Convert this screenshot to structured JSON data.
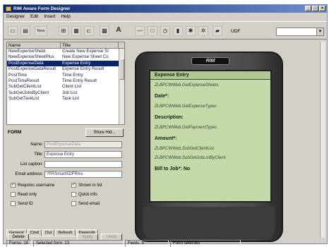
{
  "window": {
    "title": "RIM Aware Form Designer"
  },
  "menu": [
    "Designer",
    "Edit",
    "Insert",
    "Help"
  ],
  "toolbar": {
    "buttons": [
      "new-icon",
      "open-icon",
      "save-icon",
      "form-icon",
      "table-icon",
      "insert-icon",
      "text-icon",
      "font-icon",
      "line-icon",
      "box-icon",
      "clock-icon",
      "star-icon",
      "gear-icon",
      "folder-icon"
    ],
    "wide_label": "New",
    "font_label": "A",
    "combo_label": "UDF"
  },
  "list": {
    "headers": [
      "Name",
      "Title"
    ],
    "rows": [
      {
        "name": "NewExpenseSheet",
        "title": "Create New Expense Sl"
      },
      {
        "name": "NewExpenseSheetPlus",
        "title": "New Expense Sheet Co"
      },
      {
        "name": "PostExpenseData",
        "title": "Expense Entry",
        "selected": true
      },
      {
        "name": "PostExpenseDataResult",
        "title": "Expense Entry Result"
      },
      {
        "name": "PostTime",
        "title": "Time Entry"
      },
      {
        "name": "PostTimeResult",
        "title": "Time Entry Result"
      },
      {
        "name": "SubGetClientList",
        "title": "Client List"
      },
      {
        "name": "SubGetJobsByClient",
        "title": "Job List"
      },
      {
        "name": "SubGetTaskList",
        "title": "Task List"
      }
    ]
  },
  "formbar": {
    "label": "FORM",
    "show_button": "Show Hid..."
  },
  "props": {
    "name_label": "Name:",
    "name_value": "PostExpenseData",
    "title_label": "Title:",
    "title_value": "Expense Entry",
    "caption_label": "List caption:",
    "caption_value": "",
    "email_label": "Email address:",
    "email_value": "?FRSmartSDFRms",
    "checks": [
      {
        "label": "Requires username",
        "checked": true
      },
      {
        "label": "Shown in list",
        "checked": true
      },
      {
        "label": "Read only",
        "checked": false
      },
      {
        "label": "Quick info",
        "checked": false
      },
      {
        "label": "Send ID",
        "checked": false
      },
      {
        "label": "Send email",
        "checked": false
      }
    ]
  },
  "tabs": [
    "General",
    "Cmd",
    "Out",
    "Refresh",
    "Depends"
  ],
  "bottom": {
    "delete": "Delete",
    "apply": "Apply",
    "undo": "Undo"
  },
  "device": {
    "logo": "RIM",
    "screen_title": "Expense Entry",
    "lines": [
      {
        "kind": "code",
        "text": "ZLBPCWWeb.GetExpenseSheets"
      },
      {
        "kind": "label",
        "text": "Date*:"
      },
      {
        "kind": "code",
        "text": "ZLBPCWWeb.GetExpenseTypes"
      },
      {
        "kind": "label",
        "text": "Description:"
      },
      {
        "kind": "code",
        "text": "ZLBPCWWeb.GetPaymentTypes"
      },
      {
        "kind": "label",
        "text": "Amount*:"
      },
      {
        "kind": "code",
        "text": "ZLBPCWWeb.SubGetClientList"
      },
      {
        "kind": "code",
        "text": "ZLBPCWWeb.SubGetJobListByClient"
      },
      {
        "kind": "label",
        "text": "Bill to Job*: No"
      }
    ]
  },
  "status": [
    "Forms: 19",
    "Selected form: 13",
    "Fields: 9",
    "Form selected"
  ]
}
